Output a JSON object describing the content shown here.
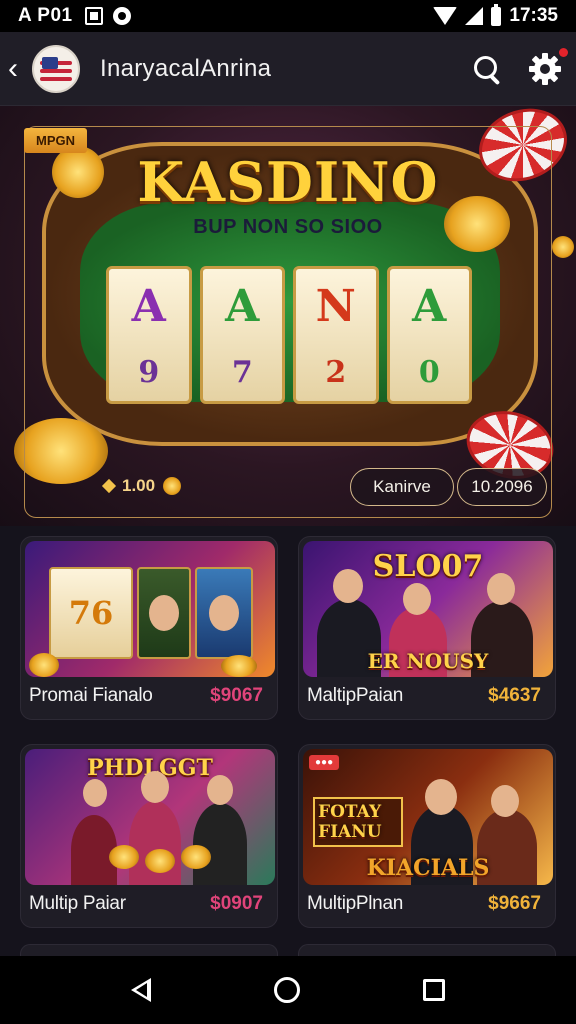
{
  "status_bar": {
    "left_time": "A P01",
    "right_time": "17:35"
  },
  "app_bar": {
    "title": "InaryacalAnrina"
  },
  "hero": {
    "tag": "MPGN",
    "title": "KASDINO",
    "subtitle": "BUP NON SO SIOO",
    "reels": [
      [
        "A",
        "9"
      ],
      [
        "A",
        "7"
      ],
      [
        "N",
        "2"
      ],
      [
        "A",
        "0"
      ]
    ],
    "info_value": "1.00",
    "pill_left": "Kanirve",
    "pill_right": "10.2096"
  },
  "cards": [
    {
      "label": "Promai Fianalo",
      "price": "$9067",
      "price_color": "#e0447a",
      "banner": "",
      "reel_digits": [
        "7",
        "6"
      ]
    },
    {
      "label": "MaltipPaian",
      "price": "$4637",
      "price_color": "#f0b33a",
      "banner": "SLO07",
      "banner2": "ER NOUSY"
    },
    {
      "label": "Multip Paiar",
      "price": "$0907",
      "price_color": "#e0447a",
      "banner": "PHDLGGT"
    },
    {
      "label": "MultipPlnan",
      "price": "$9667",
      "price_color": "#f0b33a",
      "banner": "FOTAY FIANU",
      "banner2": "KIACIALS"
    }
  ],
  "colors": {
    "accent_gold": "#ffd23c",
    "background": "#15131c",
    "card": "#1f1d26"
  },
  "icons": [
    "back-icon",
    "search-icon",
    "gear-icon",
    "nav-back-icon",
    "nav-home-icon",
    "nav-recents-icon"
  ]
}
